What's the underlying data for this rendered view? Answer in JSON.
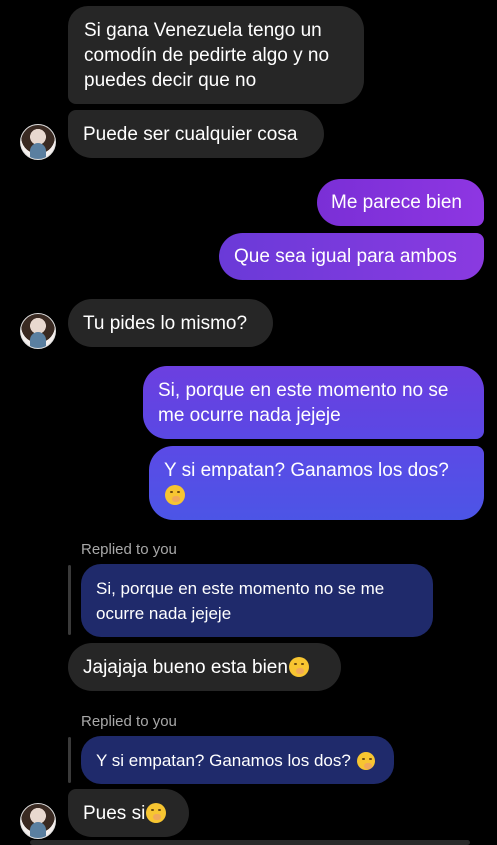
{
  "messages": {
    "m1": {
      "lines": [
        "Si gana Venezuela tengo un",
        "comodín de pedirte algo y no",
        "puedes decir que no"
      ]
    },
    "m2": {
      "text": "Puede ser cualquier cosa"
    },
    "m3": {
      "text": "Me parece bien"
    },
    "m4": {
      "text": "Que sea igual para ambos"
    },
    "m5": {
      "text": "Tu pides lo mismo?"
    },
    "m6": {
      "lines": [
        "Si, porque en este momento no se",
        "me ocurre nada jejeje"
      ]
    },
    "m7": {
      "lines": [
        "Y si empatan? Ganamos los dos?"
      ],
      "emoji": "face-with-hand-over-mouth"
    },
    "r1": {
      "label": "Replied to you",
      "lines": [
        "Si, porque en este momento no se me",
        "ocurre nada jejeje"
      ]
    },
    "m8": {
      "text": "Jajajaja bueno esta bien",
      "emoji": "face-with-hand-over-mouth"
    },
    "r2": {
      "label": "Replied to you",
      "text": "Y si empatan? Ganamos los dos?",
      "emoji": "face-with-hand-over-mouth"
    },
    "m9": {
      "text": "Pues si",
      "emoji": "face-with-hand-over-mouth"
    }
  },
  "colors": {
    "background": "#000000",
    "incoming": "#262626",
    "reply_quote": "#1f2a6b",
    "outgoing_top": "#8e36e2",
    "outgoing_bottom": "#4c55e6"
  }
}
